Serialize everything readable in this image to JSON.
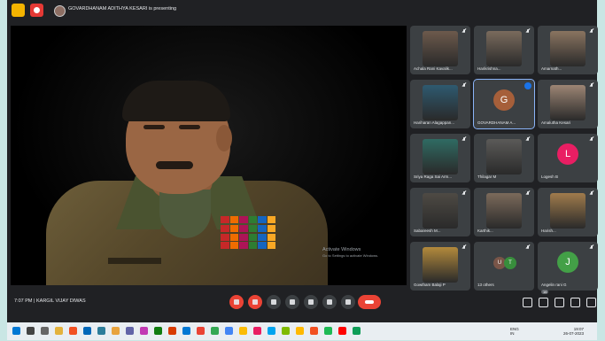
{
  "top_bar": {
    "files_icon": "folder-icon",
    "record_icon": "record-icon",
    "presenting_text": "GOVARDHANAM ADITHYA KESARI is presenting"
  },
  "stage": {
    "watermark_line1": "Activate Windows",
    "watermark_line2": "Go to Settings to activate Windows."
  },
  "participants": [
    {
      "name": "Achala Rani Kavalik...",
      "kind": "video",
      "color": "#6d5a4c"
    },
    {
      "name": "Harikrishna...",
      "kind": "video",
      "color": "#7a6b5d"
    },
    {
      "name": "Amarnath...",
      "kind": "video",
      "color": "#8a7460"
    },
    {
      "name": "Hariharan Alagappan...",
      "kind": "video",
      "color": "#2e5a70"
    },
    {
      "name": "GOVARDHANAM A...",
      "kind": "avatar",
      "initial": "G",
      "color": "#a65f3a",
      "active": true
    },
    {
      "name": "Amalutha Kesari",
      "kind": "video",
      "color": "#9c8574"
    },
    {
      "name": "Sriya Raga Sai Arm...",
      "kind": "video",
      "color": "#2f6b63"
    },
    {
      "name": "Thilagar M",
      "kind": "video",
      "color": "#5b5a58"
    },
    {
      "name": "Logesh B",
      "kind": "avatar",
      "initial": "L",
      "color": "#e91e63"
    },
    {
      "name": "Sabareesh M...",
      "kind": "video",
      "color": "#4e4a44"
    },
    {
      "name": "Karthik...",
      "kind": "video",
      "color": "#7b6a5b"
    },
    {
      "name": "Harish...",
      "kind": "video",
      "color": "#a07b4c"
    },
    {
      "name": "Gowtham Balaji P",
      "kind": "video",
      "color": "#b38a3c"
    },
    {
      "name": "13 others",
      "kind": "others",
      "initials": [
        "U",
        "T"
      ]
    },
    {
      "name": "Angelin rani G",
      "kind": "avatar",
      "initial": "J",
      "color": "#43a047"
    }
  ],
  "bottom_bar": {
    "time": "7:07 PM",
    "separator": "|",
    "meeting_name": "KARGIL VIJAY DIWAS",
    "participant_badge": "16",
    "controls": [
      {
        "name": "mic-off-button",
        "style": "red"
      },
      {
        "name": "camera-off-button",
        "style": "red"
      },
      {
        "name": "captions-button",
        "style": "gray"
      },
      {
        "name": "emoji-button",
        "style": "gray"
      },
      {
        "name": "present-button",
        "style": "gray"
      },
      {
        "name": "raise-hand-button",
        "style": "gray"
      },
      {
        "name": "more-options-button",
        "style": "gray"
      }
    ]
  },
  "taskbar": {
    "lang": "ENG",
    "lang2": "IN",
    "time": "19:07",
    "date": "26-07-2023"
  },
  "colors": {
    "meet_bg": "#202124",
    "tile_bg": "#3c4043",
    "accent_red": "#ea4335",
    "accent_blue": "#8ab4f8",
    "page_bg": "#c9e6e4"
  }
}
